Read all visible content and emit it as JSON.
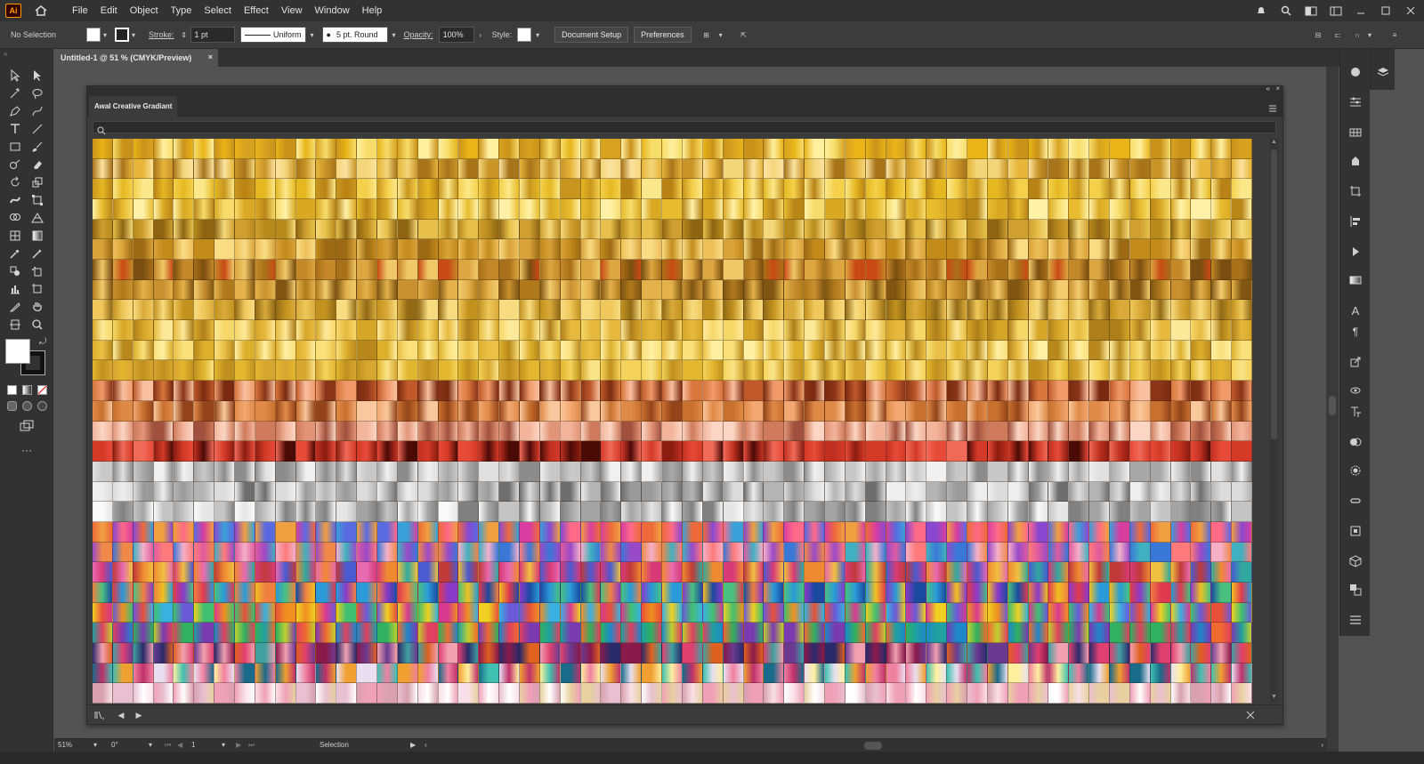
{
  "app": {
    "logo_text": "Ai",
    "menu": [
      "File",
      "Edit",
      "Object",
      "Type",
      "Select",
      "Effect",
      "View",
      "Window",
      "Help"
    ]
  },
  "controlbar": {
    "selection_label": "No Selection",
    "stroke_label": "Stroke:",
    "stroke_weight": "1 pt",
    "stroke_profile": "Uniform",
    "brush": "5 pt. Round",
    "opacity_label": "Opacity:",
    "opacity_value": "100%",
    "style_label": "Style:",
    "document_setup": "Document Setup",
    "preferences": "Preferences"
  },
  "document": {
    "tab_title": "Untitled-1 @ 51 % (CMYK/Preview)",
    "close_glyph": "×"
  },
  "panel": {
    "tab_title": "Awal Creative Gradiant",
    "collapse_glyph": "«",
    "close_glyph": "×",
    "rows": 28,
    "columns": 57,
    "row_palettes": [
      [
        "#e8b418",
        "#f6dd6a",
        "#c9921a",
        "#fff0a0",
        "#d8a221"
      ],
      [
        "#c99528",
        "#f4d67a",
        "#a8741a",
        "#fbe3a0",
        "#e6b53a"
      ],
      [
        "#e5b822",
        "#fbe88a",
        "#c8961e",
        "#f5d04a",
        "#b98214"
      ],
      [
        "#d9a924",
        "#f7dc6c",
        "#b98618",
        "#fff2a8",
        "#e8bc2e"
      ],
      [
        "#b88a1c",
        "#e6c04a",
        "#8e6412",
        "#f4d97a",
        "#cfa030"
      ],
      [
        "#c38b1a",
        "#eec05a",
        "#9c6a14",
        "#f9dc84",
        "#d9a23a"
      ],
      [
        "#a87018",
        "#dca640",
        "#7a4e10",
        "#f0c868",
        "#c48828",
        "#c94a14"
      ],
      [
        "#b07a1c",
        "#e3b24a",
        "#815612",
        "#f3cc6e",
        "#c99030"
      ],
      [
        "#c3921e",
        "#efc75a",
        "#926a16",
        "#f8dc80",
        "#d9aa3a"
      ],
      [
        "#d6a628",
        "#f6d868",
        "#ae7e1a",
        "#fde99a",
        "#e6b93e"
      ],
      [
        "#ddb02c",
        "#f9e07a",
        "#b8881c",
        "#fff0a4",
        "#ebc046"
      ],
      [
        "#e2b62e",
        "#fae488",
        "#c0901e",
        "#f5d35a",
        "#d7a630"
      ],
      [
        "#c0592a",
        "#f09a6a",
        "#8a3418",
        "#f8c0a0",
        "#d8763c",
        "#7a2a10"
      ],
      [
        "#c8702e",
        "#f2a870",
        "#94441a",
        "#f9c89c",
        "#e08a48"
      ],
      [
        "#cf7a5a",
        "#f3b49c",
        "#a0503c",
        "#fbd6c4",
        "#e29478"
      ],
      [
        "#c03020",
        "#e84a38",
        "#8a1c10",
        "#f06a58",
        "#d43a28",
        "#4a0a06"
      ],
      [
        "#c8c8c8",
        "#f0f0f0",
        "#8c8c8c",
        "#e0e0e0",
        "#a8a8a8"
      ],
      [
        "#b4b4b4",
        "#eeeeee",
        "#6e6e6e",
        "#dcdcdc",
        "#9a9a9a"
      ],
      [
        "#c4c4c4",
        "#fafafa",
        "#808080",
        "#e6e6e6",
        "#a4a4a4"
      ],
      [
        "#ee6a3a",
        "#5a6ae0",
        "#d83ea0",
        "#3aa0d8",
        "#f0a040",
        "#8a48d0",
        "#ff6a88"
      ],
      [
        "#e05aa0",
        "#3a78d8",
        "#f08848",
        "#9a4ac8",
        "#ff7a7a",
        "#40b0c0",
        "#f5b0c8"
      ],
      [
        "#d83a78",
        "#f08a30",
        "#4a5ad0",
        "#e86ab0",
        "#30a8a0",
        "#c03a3a",
        "#f0c040"
      ],
      [
        "#2a9ad8",
        "#f0c020",
        "#e03a50",
        "#4ac080",
        "#8a3ac8",
        "#f08040",
        "#1a4aa0"
      ],
      [
        "#f0d020",
        "#3ab0e0",
        "#e8503a",
        "#40c070",
        "#d83a90",
        "#6a5ad8",
        "#f09020"
      ],
      [
        "#1e88c8",
        "#30b060",
        "#c0d030",
        "#e04060",
        "#7a3ab0",
        "#f06a30",
        "#20a0a0"
      ],
      [
        "#8a1a4a",
        "#e04070",
        "#2a2a6a",
        "#f0a0b0",
        "#40a0a0",
        "#e06020",
        "#6a3a90"
      ],
      [
        "#1a6a8a",
        "#f0a030",
        "#c0306a",
        "#fff0a0",
        "#40c0b0",
        "#f080a0",
        "#e8e0f0"
      ],
      [
        "#f0a0b8",
        "#ffffff",
        "#e8c0d0",
        "#d8a0b0",
        "#f8e0e8",
        "#e8d0a0"
      ]
    ]
  },
  "statusbar": {
    "zoom": "51%",
    "rotation": "0°",
    "artboard": "1",
    "tool": "Selection"
  }
}
